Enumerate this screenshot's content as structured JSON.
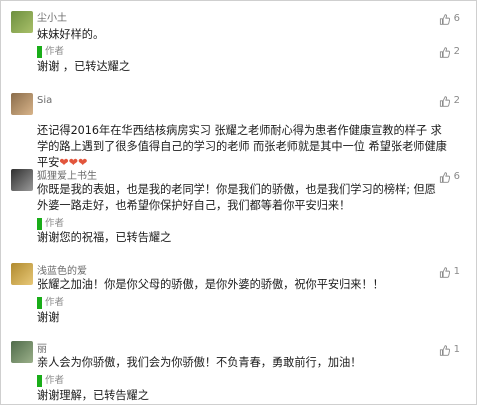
{
  "comments": [
    {
      "name": "尘小土",
      "text": "妹妹好样的。",
      "likes": "6",
      "author_label": "作者",
      "author_likes": "2",
      "reply": "谢谢 ，已转达耀之",
      "avatar_color": "#6d8f3e"
    },
    {
      "name": "Sia",
      "text": "还记得2016年在华西结核病房实习 张耀之老师耐心得为患者作健康宣教的样子 求学的路上遇到了很多值得自己的学习的老师 而张老师就是其中一位 希望张老师健康平安",
      "hearts": "❤❤❤",
      "likes": "2",
      "avatar_color": "#8a6c4a"
    },
    {
      "name": "狐狸爱上书生",
      "text": "你既是我的表姐，也是我的老同学！你是我们的骄傲，也是我们学习的榜样; 但愿外婆一路走好，也希望你保护好自己，我们都等着你平安归来！",
      "likes": "6",
      "author_label": "作者",
      "reply": "谢谢您的祝福，已转告耀之",
      "avatar_color": "#3a3a3a"
    },
    {
      "name": "浅蓝色的爱",
      "text": "张耀之加油！你是你父母的骄傲，是你外婆的骄傲，祝你平安归来！！",
      "likes": "1",
      "author_label": "作者",
      "reply": "谢谢",
      "avatar_color": "#b08a2e"
    },
    {
      "name": "丽",
      "text": "亲人会为你骄傲，我们会为你骄傲！不负青春，勇敢前行，加油！",
      "likes": "1",
      "author_label": "作者",
      "reply": "谢谢理解，已转告耀之",
      "avatar_color": "#4f6b4a"
    }
  ],
  "colors": {
    "accent_green": "#1aad19",
    "like_gray": "#8a8a8a"
  },
  "icons": {
    "like": "thumbs-up-icon"
  }
}
